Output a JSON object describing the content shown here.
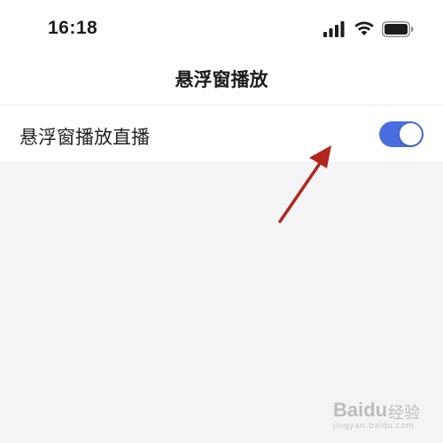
{
  "status_bar": {
    "time": "16:18",
    "signal_icon": "cellular-signal-icon",
    "wifi_icon": "wifi-icon",
    "battery_icon": "battery-icon"
  },
  "header": {
    "title": "悬浮窗播放"
  },
  "settings": [
    {
      "label": "悬浮窗播放直播",
      "toggle_on": true,
      "toggle_color": "#4a6ee0"
    }
  ],
  "annotation": {
    "arrow_color": "#b0271e",
    "arrow_icon": "red-arrow-annotation"
  },
  "watermark": {
    "brand": "Baidu",
    "sub": "经验",
    "url": "jingyan.baidu.com"
  }
}
